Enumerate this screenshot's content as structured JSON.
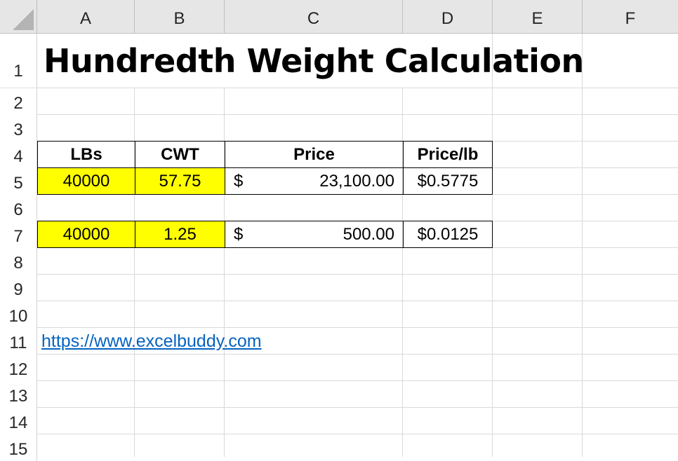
{
  "columns": [
    "A",
    "B",
    "C",
    "D",
    "E",
    "F"
  ],
  "rows": [
    "1",
    "2",
    "3",
    "4",
    "5",
    "6",
    "7",
    "8",
    "9",
    "10",
    "11",
    "12",
    "13",
    "14",
    "15"
  ],
  "title": "Hundredth Weight Calculation",
  "table": {
    "headers": {
      "lbs": "LBs",
      "cwt": "CWT",
      "price": "Price",
      "price_per_lb": "Price/lb"
    },
    "row5": {
      "lbs": "40000",
      "cwt": "57.75",
      "currency": "$",
      "price": "23,100.00",
      "price_per_lb": "$0.5775"
    },
    "row7": {
      "lbs": "40000",
      "cwt": "1.25",
      "currency": "$",
      "price": "500.00",
      "price_per_lb": "$0.0125"
    }
  },
  "link": "https://www.excelbuddy.com",
  "colors": {
    "input_fill": "#ffff00",
    "link": "#0563c1",
    "header_bg": "#e6e6e6"
  }
}
